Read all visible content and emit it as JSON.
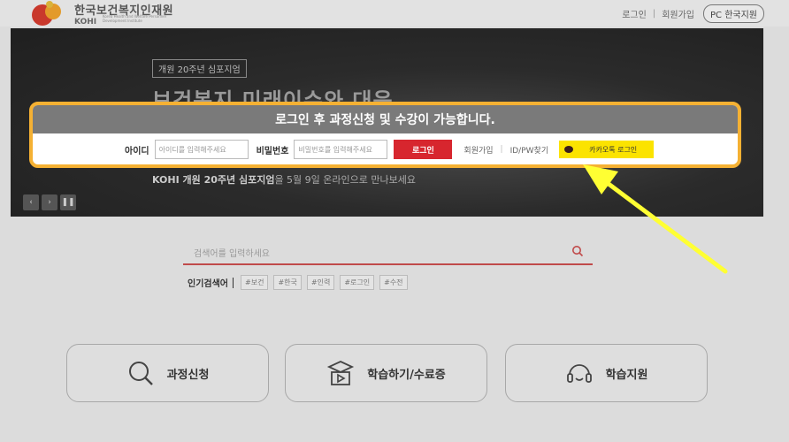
{
  "header": {
    "logo_ko": "한국보건복지인재원",
    "logo_en": "KOHI",
    "logo_sub": "Korea Health and Welfare Personnel Development Institute",
    "login": "로그인",
    "signup": "회원가입",
    "pc_version": "PC 한국지원"
  },
  "banner": {
    "tag": "개원 20주년 심포지엄",
    "title": "보건복지 미래이슈와 대응",
    "desc_bold": "KOHI 개원 20주년 심포지엄",
    "desc_rest": "을 5월 9일 온라인으로 만나보세요",
    "controls": [
      "‹",
      "›",
      "❚❚"
    ]
  },
  "login_box": {
    "heading": "로그인 후 과정신청 및 수강이 가능합니다.",
    "id_label": "아이디",
    "id_placeholder": "아이디를 입력해주세요",
    "pw_label": "비밀번호",
    "pw_placeholder": "비밀번호를 입력해주세요",
    "login_button": "로그인",
    "signup_link": "회원가입",
    "find_link": "ID/PW찾기",
    "kakao_button": "카카오톡 로그인"
  },
  "search": {
    "placeholder": "검색어를 입력하세요",
    "popular_title": "인기검색어",
    "tags": [
      "#보건",
      "#한국",
      "#인력",
      "#로그인",
      "#수전"
    ]
  },
  "cards": [
    {
      "label": "과정신청",
      "icon": "search-icon"
    },
    {
      "label": "학습하기/수료증",
      "icon": "graduation-book-icon"
    },
    {
      "label": "학습지원",
      "icon": "headset-icon"
    }
  ],
  "colors": {
    "highlight": "#f5b133",
    "login_button": "#d7262e",
    "kakao": "#fbe300",
    "arrow": "#ffff33",
    "search_underline": "#c04a4a"
  }
}
